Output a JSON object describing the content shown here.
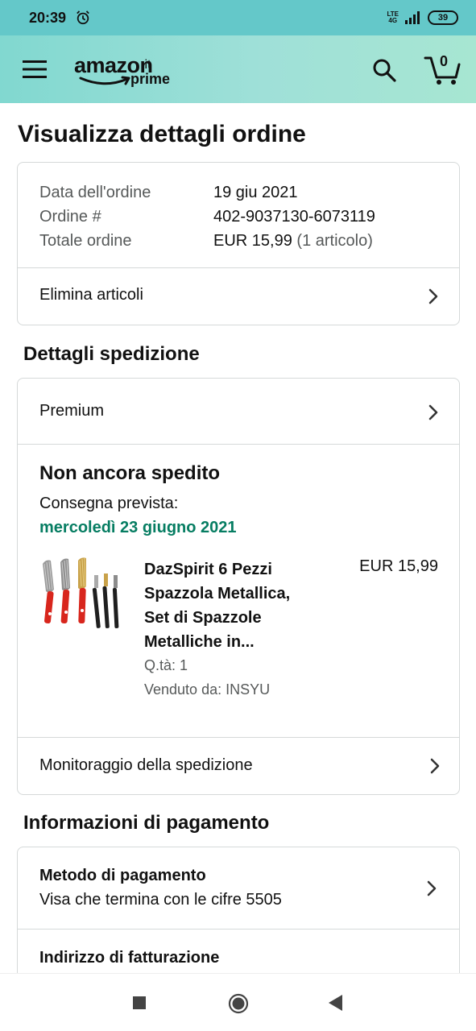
{
  "status_bar": {
    "time": "20:39",
    "network_top": "LTE",
    "network_bottom": "4G",
    "battery": "39"
  },
  "header": {
    "logo_text": "amazon",
    "logo_tld": ".it",
    "logo_prime": "prime",
    "cart_count": "0"
  },
  "page_title": "Visualizza dettagli ordine",
  "order_summary": {
    "rows": [
      {
        "label": "Data dell'ordine",
        "value": "19 giu 2021"
      },
      {
        "label": "Ordine #",
        "value": "402-9037130-6073119"
      },
      {
        "label": "Totale ordine",
        "value": "EUR 15,99",
        "extra": "(1 articolo)"
      }
    ],
    "delete_items_label": "Elimina articoli"
  },
  "shipping": {
    "heading": "Dettagli spedizione",
    "speed_label": "Premium",
    "status_title": "Non ancora spedito",
    "delivery_label": "Consegna prevista:",
    "delivery_date": "mercoledì 23 giugno 2021",
    "product": {
      "name_lines": [
        "DazSpirit 6 Pezzi",
        "Spazzola Metallica,",
        "Set di Spazzole",
        "Metalliche in..."
      ],
      "price": "EUR 15,99",
      "quantity": "Q.tà: 1",
      "seller": "Venduto da: INSYU"
    },
    "tracking_label": "Monitoraggio della spedizione"
  },
  "payment": {
    "heading": "Informazioni di pagamento",
    "method_title": "Metodo di pagamento",
    "method_value": "Visa che termina con le cifre 5505",
    "billing_title": "Indirizzo di fatturazione"
  },
  "colors": {
    "appbar_start": "#81d8d0",
    "appbar_end": "#a7e6d2",
    "statusbar": "#64c8c9",
    "delivery_green": "#067d62",
    "muted_text": "#565959",
    "border": "#d5d9d9"
  }
}
